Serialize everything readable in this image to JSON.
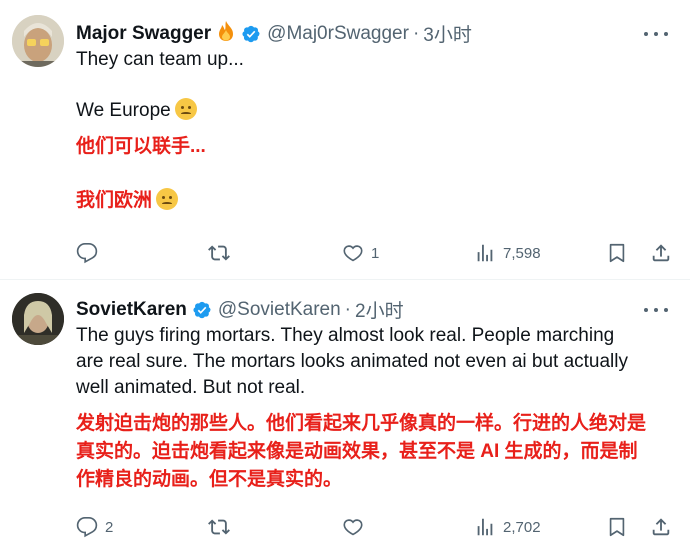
{
  "tweets": [
    {
      "display_name": "Major Swagger",
      "handle": "@Maj0rSwagger",
      "dot": "·",
      "time": "3小时",
      "lines": [
        "They can team up...",
        "We Europe",
        "他们可以联手...",
        "我们欧洲"
      ],
      "actions": {
        "reply": "",
        "repost": "",
        "like": "1",
        "views": "7,598"
      }
    },
    {
      "display_name": "SovietKaren",
      "handle": "@SovietKaren",
      "dot": "·",
      "time": "2小时",
      "lines": [
        "The guys firing mortars. They almost look real. People marching",
        "are real sure. The mortars looks animated not even ai but actually",
        "well animated. But not real.",
        "发射迫击炮的那些人。他们看起来几乎像真的一样。行进的人绝对是",
        "真实的。迫击炮看起来像是动画效果，甚至不是 AI 生成的，而是制",
        "作精良的动画。但不是真实的。"
      ],
      "actions": {
        "reply": "2",
        "repost": "",
        "like": "",
        "views": "2,702"
      }
    }
  ],
  "colors": {
    "text": "#0f1419",
    "secondary": "#536471",
    "verified": "#1d9bf0",
    "translation_red": "#e8201a"
  },
  "icons": [
    "flame-emoji",
    "verified-badge-icon",
    "more-icon",
    "reply-icon",
    "repost-icon",
    "like-icon",
    "views-icon",
    "bookmark-icon",
    "share-icon",
    "woozy-face-emoji"
  ]
}
